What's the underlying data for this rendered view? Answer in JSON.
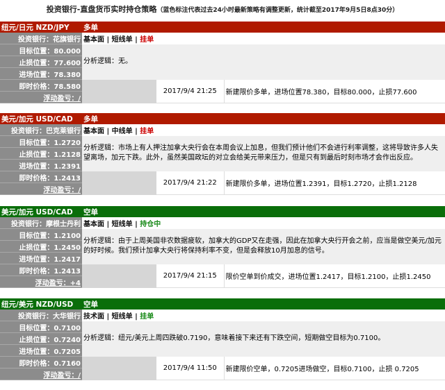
{
  "title": "投资银行-直盘货币实时持仓策略",
  "subtitle": "（蓝色标注代表过去24小时最新策略有调整更新，统计截至2017年9月5日8点30分）",
  "sep": " | ",
  "blocks": [
    {
      "pair": "纽元/日元 NZD/JPY",
      "direction": "多单",
      "color": "red",
      "bank": "投资银行：花旗银行",
      "tag1": "基本面",
      "tag2": "短线单",
      "status": "挂单",
      "status_color": "#cc0000",
      "target": "目标位置：80.000",
      "stop": "止损位置：77.600",
      "entry": "进场位置：78.380",
      "price": "即时价格：78.580",
      "float": "浮动盈亏：/",
      "analysis": "分析逻辑：无。",
      "date": "2017/9/4 21:25",
      "note": "新建限价多单，进场位置78.380，目标80.000，止损77.600"
    },
    {
      "pair": "美元/加元 USD/CAD",
      "direction": "多单",
      "color": "red",
      "bank": "投资银行：巴克莱银行",
      "tag1": "基本面",
      "tag2": "中线单",
      "status": "挂单",
      "status_color": "#cc0000",
      "target": "目标位置：1.2720",
      "stop": "止损位置：1.2128",
      "entry": "进场位置：1.2391",
      "price": "即时价格：1.2413",
      "float": "浮动盈亏：/",
      "analysis": "分析逻辑：市场上有人押注加拿大央行会在本周会议上加息，但我们预计他们不会进行利率调整，这将导致许多人失望离场，加元下跌。此外，虽然美国政坛的对立会给美元带来压力，但是只有到最后时刻市场才会作出反应。",
      "date": "2017/9/4 21:22",
      "note": "新建限价多单，进场位置1.2391，目标1.2720，止损1.2128"
    },
    {
      "pair": "美元/加元 USD/CAD",
      "direction": "空单",
      "color": "green",
      "bank": "投资银行：摩根士丹利",
      "tag1": "基本面",
      "tag2": "短线单",
      "status": "持仓中",
      "status_color": "#1a8a1a",
      "target": "目标位置：1.2100",
      "stop": "止损位置：1.2450",
      "entry": "进场位置：1.2417",
      "price": "即时价格：1.2413",
      "float": "浮动盈亏：+4",
      "analysis": "分析逻辑：由于上周美国非农数据疲软，加拿大的GDP又在走强，因此在加拿大央行开会之前，应当是做空美元/加元的好时候。我们预计加拿大央行将保持利率不变，但是会释放10月加息的信号。",
      "date": "2017/9/4 21:15",
      "note": "限价空单到价成交，进场位置1.2417，目标1.2100，止损1.2450"
    },
    {
      "pair": "纽元/美元 NZD/USD",
      "direction": "空单",
      "color": "green",
      "bank": "投资银行：大华银行",
      "tag1": "技术面",
      "tag2": "短线单",
      "status": "挂单",
      "status_color": "#1a8a1a",
      "target": "目标位置：0.7100",
      "stop": "止损位置：0.7240",
      "entry": "进场位置：0.7205",
      "price": "即时价格：0.7160",
      "float": "浮动盈亏：/",
      "analysis": "分析逻辑：纽元/美元上周四跌破0.7190，意味着接下来还有下跌空间，短期做空目标为0.7100。",
      "date": "2017/9/4 11:50",
      "note": "新建限价空单，0.7205进场做空，目标0.7100，止损 0.7205"
    }
  ]
}
